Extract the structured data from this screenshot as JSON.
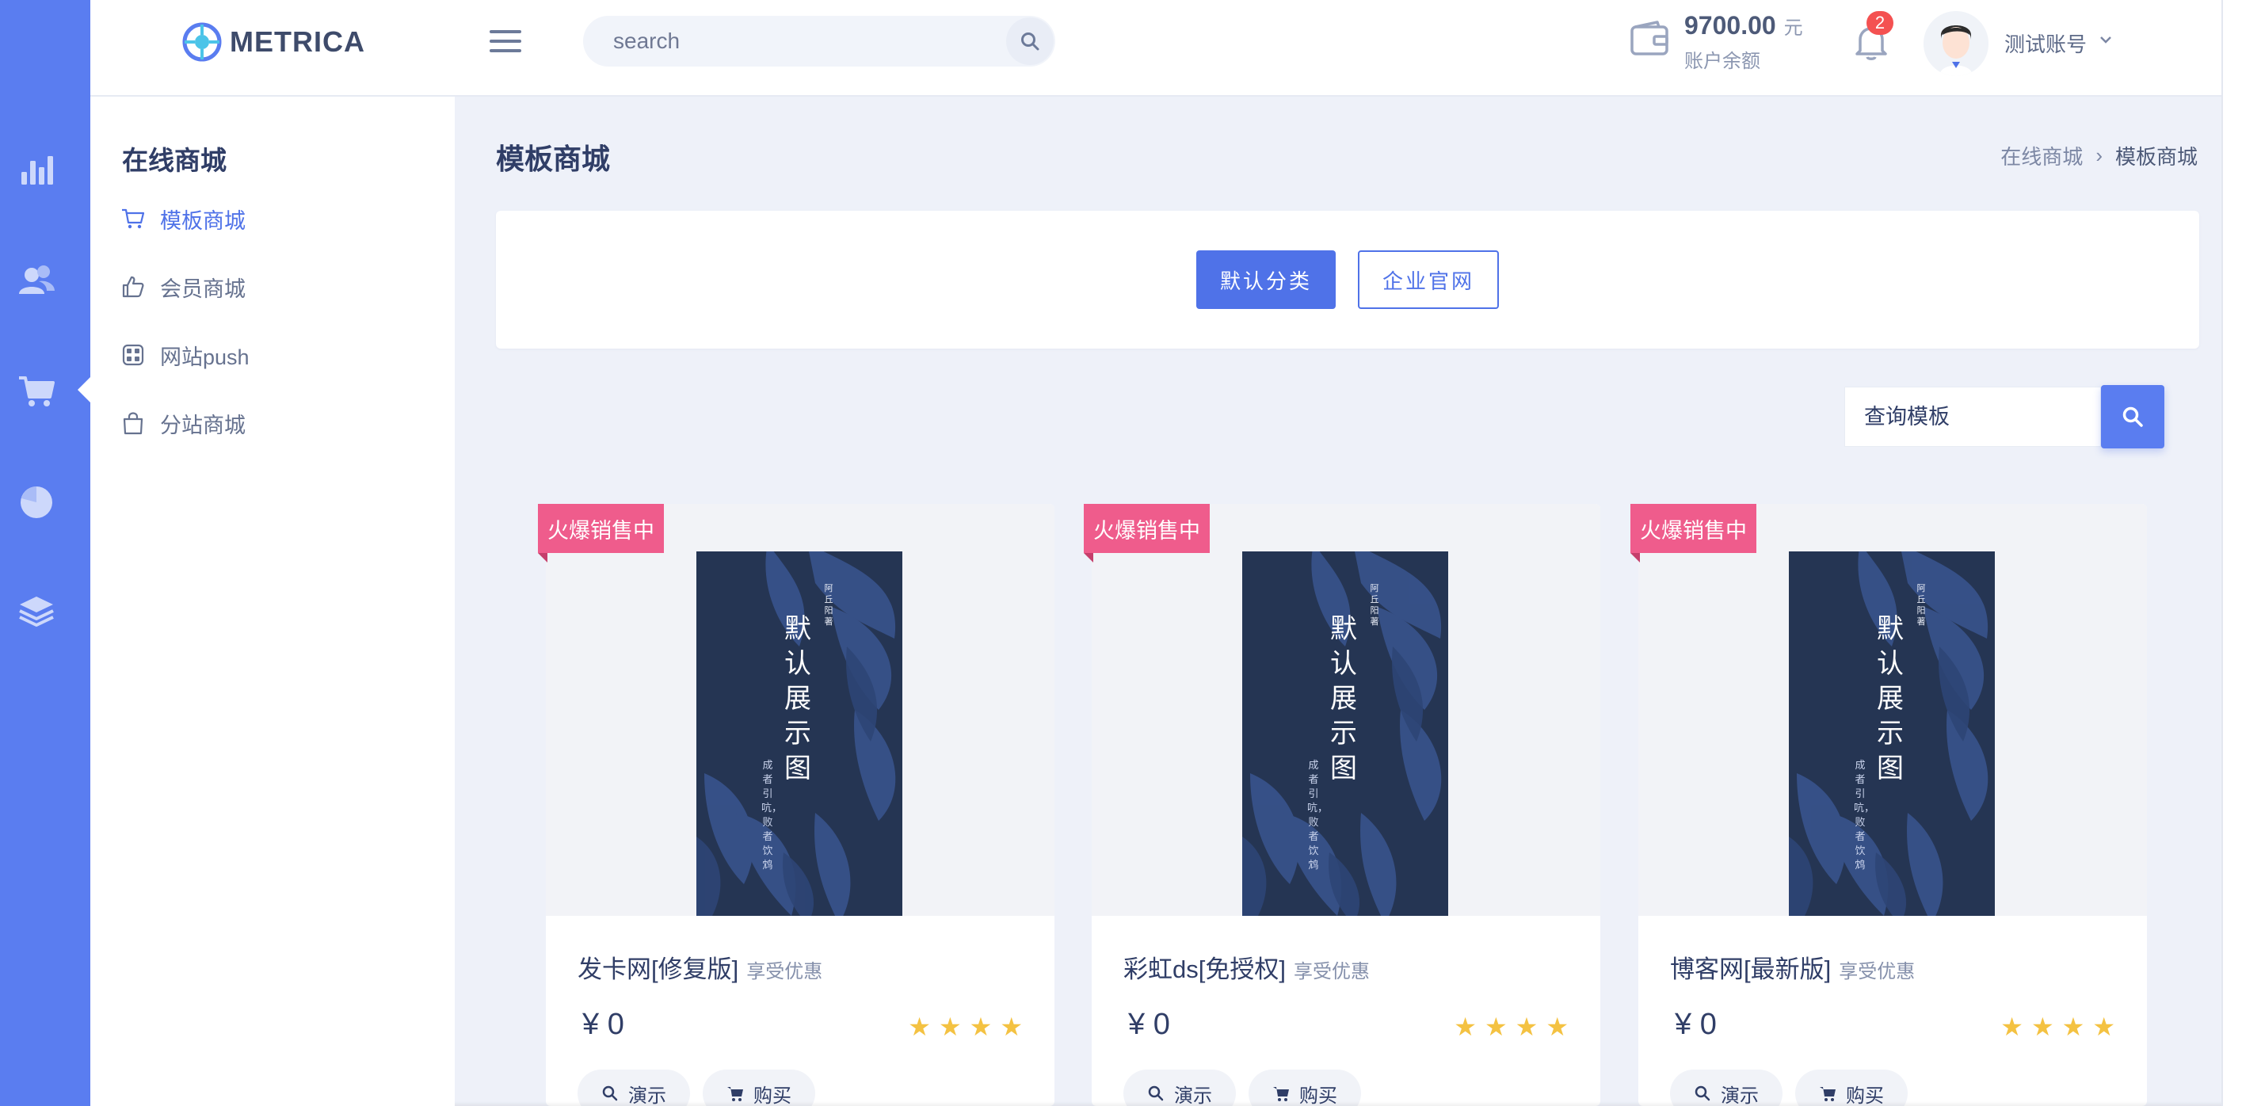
{
  "brand": {
    "name": "METRICA"
  },
  "topbar": {
    "search_placeholder": "search",
    "balance_amount": "9700.00",
    "balance_unit": "元",
    "balance_label": "账户余额",
    "notification_count": "2",
    "user_name": "测试账号"
  },
  "rail": {
    "icons": [
      "bar-chart-icon",
      "users-icon",
      "cart-icon",
      "pie-chart-icon",
      "layers-icon"
    ],
    "active": "cart-icon"
  },
  "sidebar": {
    "title": "在线商城",
    "items": [
      {
        "label": "模板商城",
        "icon": "cart-icon",
        "active": true
      },
      {
        "label": "会员商城",
        "icon": "thumb-up-icon",
        "active": false
      },
      {
        "label": "网站push",
        "icon": "slack-icon",
        "active": false
      },
      {
        "label": "分站商城",
        "icon": "shopping-bag-icon",
        "active": false
      }
    ]
  },
  "page": {
    "title": "模板商城",
    "breadcrumb": [
      "在线商城",
      "模板商城"
    ]
  },
  "filters": {
    "primary": "默认分类",
    "secondary": "企业官网"
  },
  "template_search": {
    "placeholder": "查询模板"
  },
  "products": [
    {
      "tag": "火爆销售中",
      "name": "发卡网[修复版]",
      "promo": "享受优惠",
      "price": "¥ 0",
      "rating": 4,
      "demo_label": "演示",
      "buy_label": "购买"
    },
    {
      "tag": "火爆销售中",
      "name": "彩虹ds[免授权]",
      "promo": "享受优惠",
      "price": "¥ 0",
      "rating": 4,
      "demo_label": "演示",
      "buy_label": "购买"
    },
    {
      "tag": "火爆销售中",
      "name": "博客网[最新版]",
      "promo": "享受优惠",
      "price": "¥ 0",
      "rating": 4,
      "demo_label": "演示",
      "buy_label": "购买"
    }
  ],
  "cover": {
    "title": "默认展示图",
    "author": "阿丘阳 著",
    "subtitle": "成者引吭，败者饮鸩"
  },
  "colors": {
    "rail": "#5a7df0",
    "primary": "#4f72e8",
    "tag": "#ef5c8c",
    "star": "#f4c242",
    "cover": "#253553"
  }
}
